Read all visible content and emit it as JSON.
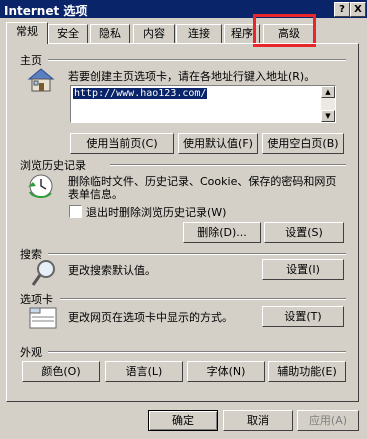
{
  "window": {
    "title": "Internet 选项",
    "help_glyph": "?",
    "close_glyph": "X"
  },
  "tabs": [
    "常规",
    "安全",
    "隐私",
    "内容",
    "连接",
    "程序",
    "高级"
  ],
  "homepage": {
    "section_title": "主页",
    "description": "若要创建主页选项卡，请在各地址行键入地址(R)。",
    "url": "http://www.hao123.com/",
    "buttons": {
      "use_current": "使用当前页(C)",
      "use_default": "使用默认值(F)",
      "use_blank": "使用空白页(B)"
    }
  },
  "history": {
    "section_title": "浏览历史记录",
    "description_line1": "删除临时文件、历史记录、Cookie、保存的密码和网页",
    "description_line2": "表单信息。",
    "checkbox_label": "退出时删除浏览历史记录(W)",
    "buttons": {
      "delete": "删除(D)...",
      "settings": "设置(S)"
    }
  },
  "search": {
    "section_title": "搜索",
    "description": "更改搜索默认值。",
    "settings": "设置(I)"
  },
  "tabs_section": {
    "section_title": "选项卡",
    "description": "更改网页在选项卡中显示的方式。",
    "settings": "设置(T)"
  },
  "appearance": {
    "section_title": "外观",
    "buttons": {
      "colors": "颜色(O)",
      "languages": "语言(L)",
      "fonts": "字体(N)",
      "accessibility": "辅助功能(E)"
    }
  },
  "footer": {
    "ok": "确定",
    "cancel": "取消",
    "apply": "应用(A)"
  },
  "colors": {
    "titlebar": "#0a246a",
    "highlight_box": "#e8262c",
    "face": "#d4d0c8"
  }
}
